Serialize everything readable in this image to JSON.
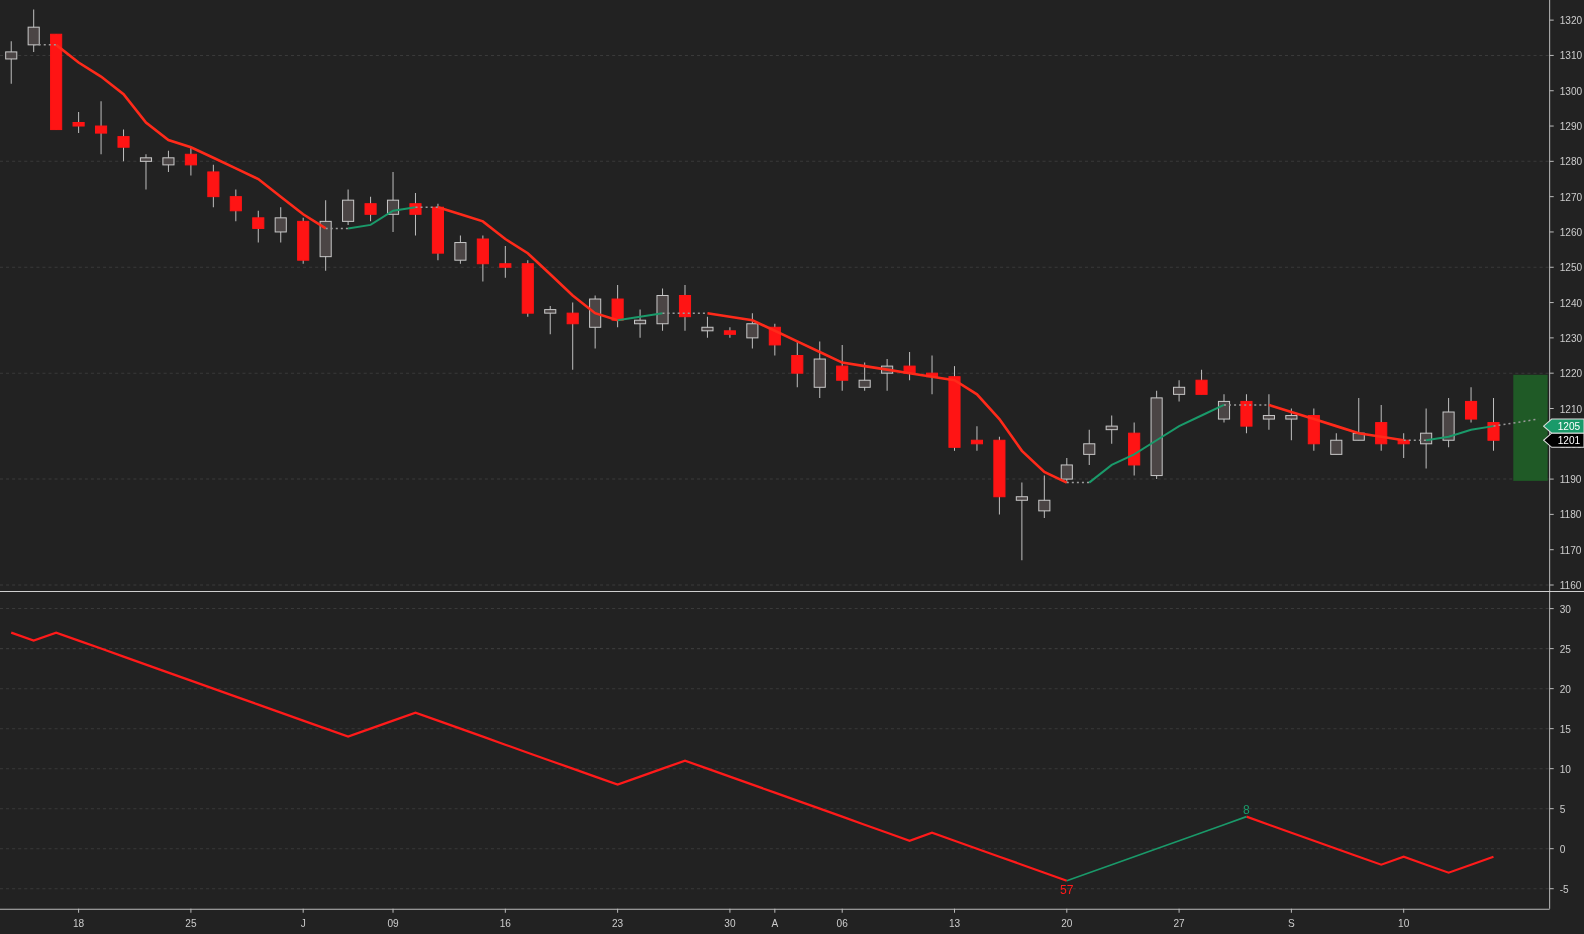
{
  "price_panel": {
    "chart_data": {
      "type": "candlestick",
      "grid": true,
      "ylim": [
        1158.3,
        1325.7
      ],
      "yticks": [
        1160,
        1170,
        1180,
        1190,
        1200,
        1210,
        1220,
        1230,
        1240,
        1250,
        1260,
        1270,
        1280,
        1290,
        1300,
        1310,
        1320
      ],
      "categories": [
        null,
        null,
        null,
        null,
        null,
        null,
        null,
        null,
        null,
        null,
        null,
        null,
        null,
        null,
        null,
        null,
        null,
        null,
        null,
        null,
        null,
        null,
        null,
        null,
        null,
        null,
        null,
        null,
        null,
        null,
        null,
        null,
        null,
        null,
        null,
        null,
        null,
        null,
        null,
        null,
        null,
        null,
        null,
        null,
        null,
        null,
        null,
        null,
        null,
        null,
        null,
        null,
        null,
        null,
        null,
        null,
        null,
        null,
        null,
        null,
        null,
        null,
        null,
        null,
        null,
        null,
        null,
        null,
        null
      ],
      "ohlc": [
        [
          1309,
          1314,
          1302,
          1311
        ],
        [
          1313,
          1323,
          1311,
          1318
        ],
        [
          1316,
          1316,
          1289,
          1289
        ],
        [
          1291,
          1294,
          1288,
          1290
        ],
        [
          1290,
          1297,
          1282,
          1288
        ],
        [
          1287,
          1289,
          1280,
          1284
        ],
        [
          1280,
          1282,
          1272,
          1281
        ],
        [
          1279,
          1283,
          1277,
          1281
        ],
        [
          1282,
          1284,
          1276,
          1279
        ],
        [
          1277,
          1279,
          1267,
          1270
        ],
        [
          1270,
          1272,
          1263,
          1266
        ],
        [
          1264,
          1266,
          1257,
          1261
        ],
        [
          1260,
          1267,
          1257,
          1264
        ],
        [
          1263,
          1264,
          1251,
          1252
        ],
        [
          1253,
          1269,
          1249,
          1263
        ],
        [
          1263,
          1272,
          1262,
          1269
        ],
        [
          1268,
          1270,
          1263,
          1265
        ],
        [
          1265,
          1277,
          1260,
          1269
        ],
        [
          1268,
          1271,
          1259,
          1265
        ],
        [
          1267,
          1268,
          1252,
          1254
        ],
        [
          1252,
          1259,
          1251,
          1257
        ],
        [
          1258,
          1259,
          1246,
          1251
        ],
        [
          1251,
          1256,
          1247,
          1250
        ],
        [
          1251,
          1252,
          1236,
          1237
        ],
        [
          1237,
          1239,
          1231,
          1238
        ],
        [
          1237,
          1240,
          1221,
          1234
        ],
        [
          1233,
          1242,
          1227,
          1241
        ],
        [
          1241,
          1245,
          1233,
          1235
        ],
        [
          1234,
          1238,
          1230,
          1235
        ],
        [
          1234,
          1244,
          1232,
          1242
        ],
        [
          1242,
          1245,
          1232,
          1236
        ],
        [
          1232,
          1236,
          1230,
          1233
        ],
        [
          1232,
          1233,
          1230,
          1231
        ],
        [
          1230,
          1237,
          1227,
          1234
        ],
        [
          1233,
          1234,
          1225,
          1228
        ],
        [
          1225,
          1229,
          1216,
          1220
        ],
        [
          1216,
          1229,
          1213,
          1224
        ],
        [
          1222,
          1228,
          1215,
          1218
        ],
        [
          1216,
          1223,
          1215,
          1218
        ],
        [
          1220,
          1224,
          1215,
          1222
        ],
        [
          1222,
          1226,
          1218,
          1220
        ],
        [
          1220,
          1225,
          1214,
          1219
        ],
        [
          1219,
          1222,
          1198,
          1199
        ],
        [
          1201,
          1205,
          1198,
          1200
        ],
        [
          1201,
          1202,
          1180,
          1185
        ],
        [
          1184,
          1189,
          1167,
          1185
        ],
        [
          1181,
          1191,
          1179,
          1184
        ],
        [
          1190,
          1196,
          1189,
          1194
        ],
        [
          1197,
          1204,
          1194,
          1200
        ],
        [
          1204,
          1208,
          1200,
          1205
        ],
        [
          1203,
          1206,
          1191,
          1194
        ],
        [
          1191,
          1215,
          1190,
          1213
        ],
        [
          1214,
          1218,
          1212,
          1216
        ],
        [
          1218,
          1221,
          1214,
          1214
        ],
        [
          1207,
          1214,
          1206,
          1212
        ],
        [
          1212,
          1214,
          1203,
          1205
        ],
        [
          1207,
          1214,
          1204,
          1208
        ],
        [
          1207,
          1210,
          1201,
          1208
        ],
        [
          1208,
          1210,
          1198,
          1200
        ],
        [
          1197,
          1203,
          1197,
          1201
        ],
        [
          1201,
          1213,
          1201,
          1203
        ],
        [
          1206,
          1211,
          1198,
          1200
        ],
        [
          1201,
          1203,
          1196,
          1200
        ],
        [
          1200,
          1210,
          1193,
          1203
        ],
        [
          1201,
          1213,
          1199,
          1209
        ],
        [
          1212,
          1216,
          1206,
          1207
        ],
        [
          1206,
          1213,
          1198,
          1201
        ],
        null,
        null
      ],
      "series": [
        {
          "type": "line",
          "color": "#ff2a1a",
          "values": [
            null,
            null,
            1313,
            1308,
            1304,
            1299,
            1291,
            1286,
            1284,
            1281,
            1278,
            1275,
            1270,
            1265,
            1261,
            null,
            null,
            null,
            null,
            1267,
            1265,
            1263,
            1258,
            1254,
            1248,
            1242,
            1237,
            1235,
            null,
            null,
            null,
            1237,
            1236,
            1235,
            1232,
            1229,
            1226,
            1223,
            1222,
            1221,
            1220,
            1219,
            1218,
            1214,
            1207,
            1198,
            1192,
            1189,
            null,
            null,
            null,
            null,
            null,
            null,
            null,
            null,
            1211,
            1209,
            1207,
            1205,
            1203,
            1202,
            1201,
            null,
            null,
            null,
            null,
            null,
            null
          ]
        },
        {
          "type": "line",
          "color": "#1a9a6a",
          "values": [
            null,
            null,
            null,
            null,
            null,
            null,
            null,
            null,
            null,
            null,
            null,
            null,
            null,
            null,
            null,
            1261,
            1262,
            1266,
            1267,
            null,
            null,
            null,
            null,
            null,
            null,
            null,
            null,
            1235,
            1236,
            1237,
            null,
            null,
            null,
            null,
            null,
            null,
            null,
            null,
            null,
            null,
            null,
            null,
            null,
            null,
            null,
            null,
            null,
            null,
            1189,
            1194,
            1197,
            1201,
            1205,
            1208,
            1211,
            null,
            null,
            null,
            null,
            null,
            null,
            null,
            null,
            1201,
            1202,
            1204,
            1205,
            null,
            null
          ]
        },
        {
          "type": "line",
          "color": "#9a9a9a",
          "line_style": "dotted",
          "values": [
            null,
            1313,
            1313,
            null,
            null,
            null,
            null,
            null,
            null,
            null,
            null,
            null,
            null,
            null,
            1261,
            1261,
            null,
            null,
            1267,
            1267,
            null,
            null,
            null,
            null,
            null,
            null,
            null,
            null,
            null,
            1237,
            1237,
            1237,
            null,
            null,
            null,
            null,
            null,
            null,
            null,
            null,
            null,
            null,
            null,
            null,
            null,
            null,
            null,
            1189,
            1189,
            null,
            null,
            null,
            null,
            null,
            1211,
            1211,
            1211,
            null,
            null,
            null,
            null,
            null,
            1201,
            1201,
            null,
            null,
            1205,
            1206,
            1207
          ]
        }
      ]
    },
    "price_tags": [
      {
        "text": "1205",
        "color": "#1a9a6a"
      },
      {
        "text": "1201",
        "color": "#000000"
      }
    ]
  },
  "indicator_panel": {
    "chart_data": {
      "type": "line",
      "grid": true,
      "ylim": [
        -7.5,
        32.2
      ],
      "yticks": [
        -5,
        0,
        5,
        10,
        15,
        20,
        25,
        30
      ],
      "categories": [
        null,
        null,
        null,
        "18",
        null,
        null,
        null,
        null,
        "25",
        null,
        null,
        null,
        null,
        "J",
        null,
        null,
        null,
        "09",
        null,
        null,
        null,
        null,
        "16",
        null,
        null,
        null,
        null,
        "23",
        null,
        null,
        null,
        null,
        "30",
        null,
        "A",
        null,
        null,
        "06",
        null,
        null,
        null,
        null,
        "13",
        null,
        null,
        null,
        null,
        "20",
        null,
        null,
        null,
        null,
        "27",
        null,
        null,
        null,
        null,
        "S",
        null,
        null,
        null,
        null,
        "10",
        null,
        null,
        null,
        null,
        null,
        null
      ],
      "series": [
        {
          "color": "#ff1a1a",
          "values": [
            27,
            26,
            27,
            26,
            25,
            24,
            23,
            22,
            21,
            20,
            19,
            18,
            17,
            16,
            15,
            14,
            15,
            16,
            17,
            16,
            15,
            14,
            13,
            12,
            11,
            10,
            9,
            8,
            9,
            10,
            11,
            10,
            9,
            8,
            7,
            6,
            5,
            4,
            3,
            2,
            1,
            2,
            1,
            0,
            -1,
            -2,
            -3,
            -4,
            null,
            null,
            null,
            null,
            null,
            null,
            null,
            4,
            3,
            2,
            1,
            0,
            -1,
            -2,
            -1,
            -2,
            -3,
            -2,
            -1,
            null,
            null
          ]
        },
        {
          "color": "#1a9a6a",
          "values": [
            null,
            null,
            null,
            null,
            null,
            null,
            null,
            null,
            null,
            null,
            null,
            null,
            null,
            null,
            null,
            null,
            null,
            null,
            null,
            null,
            null,
            null,
            null,
            null,
            null,
            null,
            null,
            null,
            null,
            null,
            null,
            null,
            null,
            null,
            null,
            null,
            null,
            null,
            null,
            null,
            null,
            null,
            null,
            null,
            null,
            null,
            null,
            -4,
            -3,
            -2,
            -1,
            0,
            1,
            2,
            3,
            4,
            null,
            null,
            null,
            null,
            null,
            null,
            null,
            null,
            null,
            null,
            null,
            null,
            null
          ]
        }
      ],
      "annotations": [
        {
          "y": -4,
          "text": "57"
        },
        {
          "y": 4,
          "text": "8"
        }
      ]
    }
  }
}
